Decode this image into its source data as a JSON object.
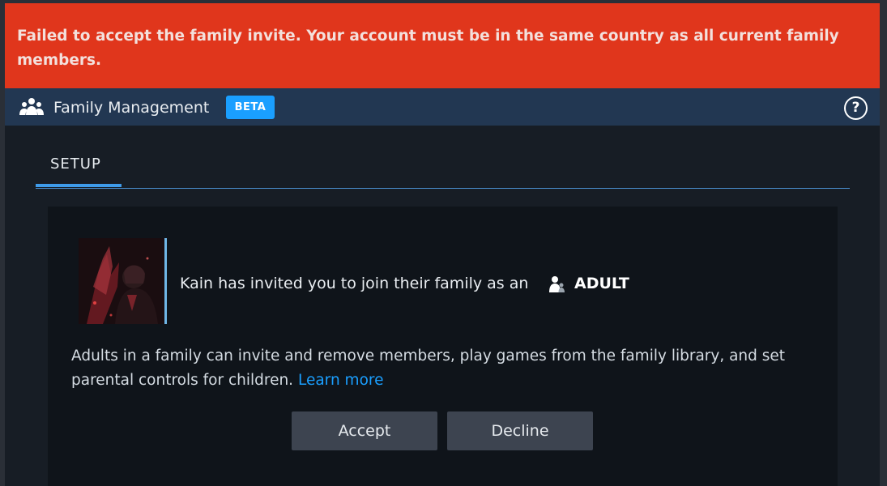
{
  "error_banner": {
    "message": "Failed to accept the family invite. Your account must be in the same country as all current family members."
  },
  "header": {
    "title": "Family Management",
    "badge": "BETA",
    "help_label": "?"
  },
  "tabs": [
    {
      "label": "SETUP",
      "active": true
    }
  ],
  "invite": {
    "text": "Kain has invited you to join their family as an",
    "role": "ADULT",
    "role_icon": "adult-person-icon"
  },
  "description": {
    "text": "Adults in a family can invite and remove members, play games from the family library, and set parental controls for children.",
    "learn_more": "Learn more"
  },
  "buttons": {
    "accept": "Accept",
    "decline": "Decline"
  },
  "colors": {
    "error_banner": "#e0361c",
    "header": "#223752",
    "accent": "#1a9fff",
    "background": "#171d25",
    "card": "#0f141a",
    "button": "#3d4450"
  }
}
